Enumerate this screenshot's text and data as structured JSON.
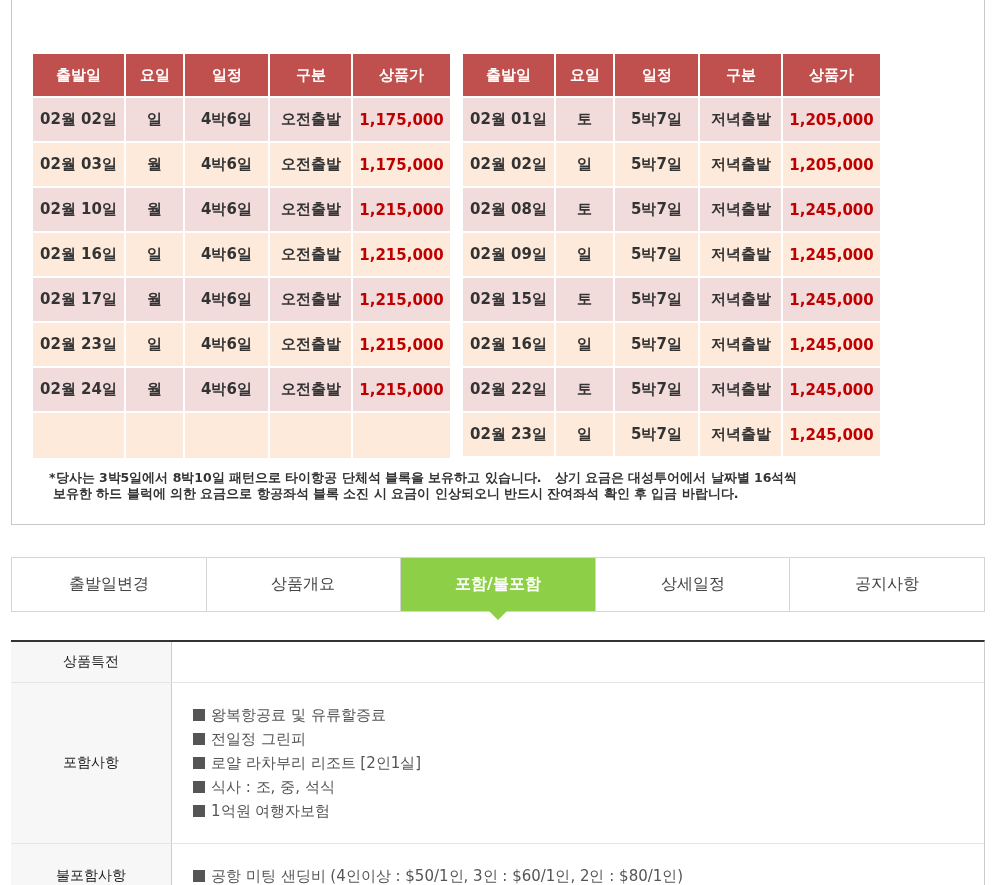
{
  "schedule_tables": [
    {
      "columns": [
        "출발일",
        "요일",
        "일정",
        "구분",
        "상품가"
      ],
      "rows": [
        [
          "02월 02일",
          "일",
          "4박6일",
          "오전출발",
          "1,175,000"
        ],
        [
          "02월 03일",
          "월",
          "4박6일",
          "오전출발",
          "1,175,000"
        ],
        [
          "02월 10일",
          "월",
          "4박6일",
          "오전출발",
          "1,215,000"
        ],
        [
          "02월 16일",
          "일",
          "4박6일",
          "오전출발",
          "1,215,000"
        ],
        [
          "02월 17일",
          "월",
          "4박6일",
          "오전출발",
          "1,215,000"
        ],
        [
          "02월 23일",
          "일",
          "4박6일",
          "오전출발",
          "1,215,000"
        ],
        [
          "02월 24일",
          "월",
          "4박6일",
          "오전출발",
          "1,215,000"
        ]
      ]
    },
    {
      "columns": [
        "출발일",
        "요일",
        "일정",
        "구분",
        "상품가"
      ],
      "rows": [
        [
          "02월 01일",
          "토",
          "5박7일",
          "저녁출발",
          "1,205,000"
        ],
        [
          "02월 02일",
          "일",
          "5박7일",
          "저녁출발",
          "1,205,000"
        ],
        [
          "02월 08일",
          "토",
          "5박7일",
          "저녁출발",
          "1,245,000"
        ],
        [
          "02월 09일",
          "일",
          "5박7일",
          "저녁출발",
          "1,245,000"
        ],
        [
          "02월 15일",
          "토",
          "5박7일",
          "저녁출발",
          "1,245,000"
        ],
        [
          "02월 16일",
          "일",
          "5박7일",
          "저녁출발",
          "1,245,000"
        ],
        [
          "02월 22일",
          "토",
          "5박7일",
          "저녁출발",
          "1,245,000"
        ],
        [
          "02월 23일",
          "일",
          "5박7일",
          "저녁출발",
          "1,245,000"
        ]
      ]
    }
  ],
  "note_lines": [
    "*당사는 3박5일에서 8박10일 패턴으로 타이항공 단체석 블록을 보유하고 있습니다.   상기 요금은 대성투어에서 날짜별 16석씩",
    "보유한 하드 블럭에 의한 요금으로 항공좌석 블록 소진 시 요금이 인상되오니 반드시 잔여좌석 확인 후 입금 바랍니다."
  ],
  "tabs": [
    {
      "label": "출발일변경",
      "selected": false
    },
    {
      "label": "상품개요",
      "selected": false
    },
    {
      "label": "포함/불포함",
      "selected": true
    },
    {
      "label": "상세일정",
      "selected": false
    },
    {
      "label": "공지사항",
      "selected": false
    }
  ],
  "info_rows": [
    {
      "label": "상품특전"
    },
    {
      "label": "포함사항",
      "items": [
        "왕복항공료 및 유류할증료",
        "전일정 그린피",
        "로얄 라차부리 리조트 [2인1실]",
        "식사 : 조, 중, 석식",
        "1억원 여행자보험"
      ]
    },
    {
      "label": "불포함사항",
      "items": [
        "공항 미팅 샌딩비 (4인이상 : $50/1인, 3인 : $60/1인, 2인 : $80/1인)"
      ]
    }
  ]
}
